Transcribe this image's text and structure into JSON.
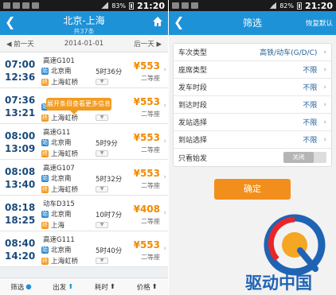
{
  "left": {
    "status": {
      "battery": "83%",
      "time": "21:20"
    },
    "header": {
      "title": "北京-上海",
      "subtitle": "共37条"
    },
    "datebar": {
      "prev": "◀ 前一天",
      "date": "2014-01-01",
      "next": "后一天 ▶"
    },
    "tooltip": "展开条目查看更多信息",
    "trains": [
      {
        "dep": "07:00",
        "arr": "12:36",
        "type": "高速",
        "no": "G101",
        "from": "北京南",
        "to": "上海虹桥",
        "duration": "5时36分",
        "price": "¥553",
        "seat": "二等座"
      },
      {
        "dep": "07:36",
        "arr": "13:21",
        "type": "",
        "no": "",
        "from": "北京南",
        "to": "上海虹桥",
        "duration": "",
        "price": "¥553",
        "seat": "二等座"
      },
      {
        "dep": "08:00",
        "arr": "13:09",
        "type": "高速",
        "no": "G11",
        "from": "北京南",
        "to": "上海虹桥",
        "duration": "5时9分",
        "price": "¥553",
        "seat": "二等座"
      },
      {
        "dep": "08:08",
        "arr": "13:40",
        "type": "高速",
        "no": "G107",
        "from": "北京南",
        "to": "上海虹桥",
        "duration": "5时32分",
        "price": "¥553",
        "seat": "二等座"
      },
      {
        "dep": "08:18",
        "arr": "18:25",
        "type": "动车",
        "no": "D315",
        "from": "北京南",
        "to": "上海",
        "duration": "10时7分",
        "price": "¥408",
        "seat": "二等座"
      },
      {
        "dep": "08:40",
        "arr": "14:20",
        "type": "高速",
        "no": "G111",
        "from": "北京南",
        "to": "上海虹桥",
        "duration": "5时40分",
        "price": "¥553",
        "seat": "二等座"
      }
    ],
    "bottom": {
      "filter": "筛选",
      "depart": "出发",
      "duration": "耗时",
      "price": "价格"
    }
  },
  "right": {
    "status": {
      "battery": "82%",
      "time": "21:20"
    },
    "header": {
      "title": "筛选",
      "reset": "恢复默认"
    },
    "filters": [
      {
        "label": "车次类型",
        "value": "高铁/动车(G/D/C)"
      },
      {
        "label": "座席类型",
        "value": "不限"
      },
      {
        "label": "发车时段",
        "value": "不限"
      },
      {
        "label": "到达时段",
        "value": "不限"
      },
      {
        "label": "发站选择",
        "value": "不限"
      },
      {
        "label": "到站选择",
        "value": "不限"
      }
    ],
    "only_origin": {
      "label": "只看始发",
      "toggle": "关闭"
    },
    "confirm": "确定",
    "brand": "驱动中国"
  }
}
